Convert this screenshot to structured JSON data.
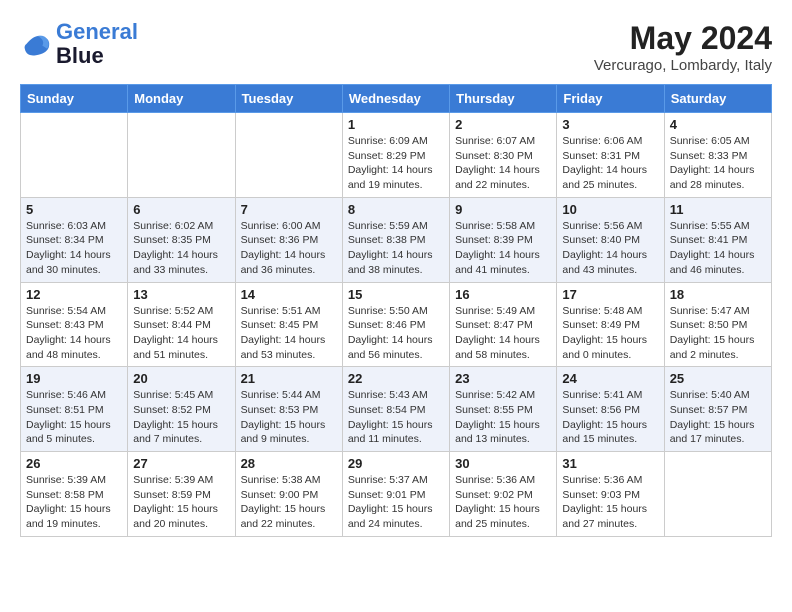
{
  "header": {
    "logo_line1": "General",
    "logo_line2": "Blue",
    "month": "May 2024",
    "location": "Vercurago, Lombardy, Italy"
  },
  "days_of_week": [
    "Sunday",
    "Monday",
    "Tuesday",
    "Wednesday",
    "Thursday",
    "Friday",
    "Saturday"
  ],
  "weeks": [
    [
      {
        "day": "",
        "info": ""
      },
      {
        "day": "",
        "info": ""
      },
      {
        "day": "",
        "info": ""
      },
      {
        "day": "1",
        "info": "Sunrise: 6:09 AM\nSunset: 8:29 PM\nDaylight: 14 hours\nand 19 minutes."
      },
      {
        "day": "2",
        "info": "Sunrise: 6:07 AM\nSunset: 8:30 PM\nDaylight: 14 hours\nand 22 minutes."
      },
      {
        "day": "3",
        "info": "Sunrise: 6:06 AM\nSunset: 8:31 PM\nDaylight: 14 hours\nand 25 minutes."
      },
      {
        "day": "4",
        "info": "Sunrise: 6:05 AM\nSunset: 8:33 PM\nDaylight: 14 hours\nand 28 minutes."
      }
    ],
    [
      {
        "day": "5",
        "info": "Sunrise: 6:03 AM\nSunset: 8:34 PM\nDaylight: 14 hours\nand 30 minutes."
      },
      {
        "day": "6",
        "info": "Sunrise: 6:02 AM\nSunset: 8:35 PM\nDaylight: 14 hours\nand 33 minutes."
      },
      {
        "day": "7",
        "info": "Sunrise: 6:00 AM\nSunset: 8:36 PM\nDaylight: 14 hours\nand 36 minutes."
      },
      {
        "day": "8",
        "info": "Sunrise: 5:59 AM\nSunset: 8:38 PM\nDaylight: 14 hours\nand 38 minutes."
      },
      {
        "day": "9",
        "info": "Sunrise: 5:58 AM\nSunset: 8:39 PM\nDaylight: 14 hours\nand 41 minutes."
      },
      {
        "day": "10",
        "info": "Sunrise: 5:56 AM\nSunset: 8:40 PM\nDaylight: 14 hours\nand 43 minutes."
      },
      {
        "day": "11",
        "info": "Sunrise: 5:55 AM\nSunset: 8:41 PM\nDaylight: 14 hours\nand 46 minutes."
      }
    ],
    [
      {
        "day": "12",
        "info": "Sunrise: 5:54 AM\nSunset: 8:43 PM\nDaylight: 14 hours\nand 48 minutes."
      },
      {
        "day": "13",
        "info": "Sunrise: 5:52 AM\nSunset: 8:44 PM\nDaylight: 14 hours\nand 51 minutes."
      },
      {
        "day": "14",
        "info": "Sunrise: 5:51 AM\nSunset: 8:45 PM\nDaylight: 14 hours\nand 53 minutes."
      },
      {
        "day": "15",
        "info": "Sunrise: 5:50 AM\nSunset: 8:46 PM\nDaylight: 14 hours\nand 56 minutes."
      },
      {
        "day": "16",
        "info": "Sunrise: 5:49 AM\nSunset: 8:47 PM\nDaylight: 14 hours\nand 58 minutes."
      },
      {
        "day": "17",
        "info": "Sunrise: 5:48 AM\nSunset: 8:49 PM\nDaylight: 15 hours\nand 0 minutes."
      },
      {
        "day": "18",
        "info": "Sunrise: 5:47 AM\nSunset: 8:50 PM\nDaylight: 15 hours\nand 2 minutes."
      }
    ],
    [
      {
        "day": "19",
        "info": "Sunrise: 5:46 AM\nSunset: 8:51 PM\nDaylight: 15 hours\nand 5 minutes."
      },
      {
        "day": "20",
        "info": "Sunrise: 5:45 AM\nSunset: 8:52 PM\nDaylight: 15 hours\nand 7 minutes."
      },
      {
        "day": "21",
        "info": "Sunrise: 5:44 AM\nSunset: 8:53 PM\nDaylight: 15 hours\nand 9 minutes."
      },
      {
        "day": "22",
        "info": "Sunrise: 5:43 AM\nSunset: 8:54 PM\nDaylight: 15 hours\nand 11 minutes."
      },
      {
        "day": "23",
        "info": "Sunrise: 5:42 AM\nSunset: 8:55 PM\nDaylight: 15 hours\nand 13 minutes."
      },
      {
        "day": "24",
        "info": "Sunrise: 5:41 AM\nSunset: 8:56 PM\nDaylight: 15 hours\nand 15 minutes."
      },
      {
        "day": "25",
        "info": "Sunrise: 5:40 AM\nSunset: 8:57 PM\nDaylight: 15 hours\nand 17 minutes."
      }
    ],
    [
      {
        "day": "26",
        "info": "Sunrise: 5:39 AM\nSunset: 8:58 PM\nDaylight: 15 hours\nand 19 minutes."
      },
      {
        "day": "27",
        "info": "Sunrise: 5:39 AM\nSunset: 8:59 PM\nDaylight: 15 hours\nand 20 minutes."
      },
      {
        "day": "28",
        "info": "Sunrise: 5:38 AM\nSunset: 9:00 PM\nDaylight: 15 hours\nand 22 minutes."
      },
      {
        "day": "29",
        "info": "Sunrise: 5:37 AM\nSunset: 9:01 PM\nDaylight: 15 hours\nand 24 minutes."
      },
      {
        "day": "30",
        "info": "Sunrise: 5:36 AM\nSunset: 9:02 PM\nDaylight: 15 hours\nand 25 minutes."
      },
      {
        "day": "31",
        "info": "Sunrise: 5:36 AM\nSunset: 9:03 PM\nDaylight: 15 hours\nand 27 minutes."
      },
      {
        "day": "",
        "info": ""
      }
    ]
  ]
}
